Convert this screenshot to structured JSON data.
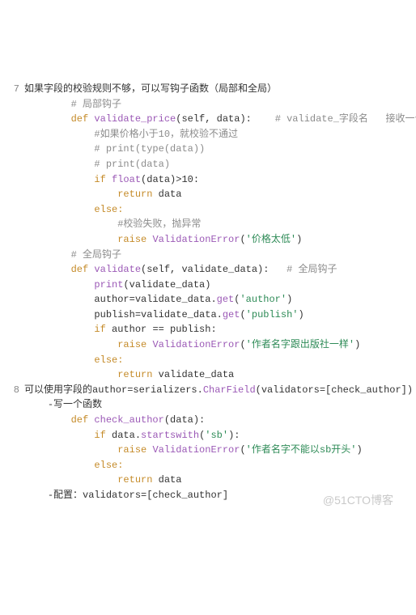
{
  "watermark": "@51CTO博客",
  "lines": {
    "l01_num": "7",
    "l01_txt": "如果字段的校验规则不够，可以写钩子函数（局部和全局）",
    "l02_cm": "# 局部钩子",
    "l03_def": "def",
    "l03_name": "validate_price",
    "l03_args": "(self, data):",
    "l03_trail": "# validate_字段名   接收一个参数",
    "l04_cm": "#如果价格小于10，就校验不通过",
    "l05_cm": "# print(type(data))",
    "l06_cm": "# print(data)",
    "l07_if": "if",
    "l07_fn": "float",
    "l07_rest": "(data)>10:",
    "l08_ret": "return",
    "l08_id": "data",
    "l09_else": "else:",
    "l10_cm": "#校验失败，抛异常",
    "l11_raise": "raise",
    "l11_cls": "ValidationError",
    "l11_open": "(",
    "l11_str": "'价格太低'",
    "l11_close": ")",
    "l12_cm": "# 全局钩子",
    "l13_def": "def",
    "l13_name": "validate",
    "l13_args": "(self, validate_data):",
    "l13_trail": "# 全局钩子",
    "l14_fn": "print",
    "l14_args": "(validate_data)",
    "l15_lhs": "author=validate_data.",
    "l15_fn": "get",
    "l15_str": "'author'",
    "l16_lhs": "publish=validate_data.",
    "l16_fn": "get",
    "l16_str": "'publish'",
    "l17_if": "if",
    "l17_cond": "author == publish:",
    "l18_raise": "raise",
    "l18_cls": "ValidationError",
    "l18_str": "'作者名字跟出版社一样'",
    "l19_else": "else:",
    "l20_ret": "return",
    "l20_id": "validate_data",
    "l21_num": "8",
    "l21_a": "可以使用字段的author=serializers.",
    "l21_fn": "CharField",
    "l21_b": "(validators=[check_author]) ，来校验",
    "l22_txt": "-写一个函数",
    "l23_def": "def",
    "l23_name": "check_author",
    "l23_args": "(data):",
    "l24_if": "if",
    "l24_lhs": "data.",
    "l24_fn": "startswith",
    "l24_str": "'sb'",
    "l24_tail": "):",
    "l25_raise": "raise",
    "l25_cls": "ValidationError",
    "l25_str": "'作者名字不能以sb开头'",
    "l26_else": "else:",
    "l27_ret": "return",
    "l27_id": "data",
    "l28_txt": "-配置：validators=[check_author]"
  }
}
